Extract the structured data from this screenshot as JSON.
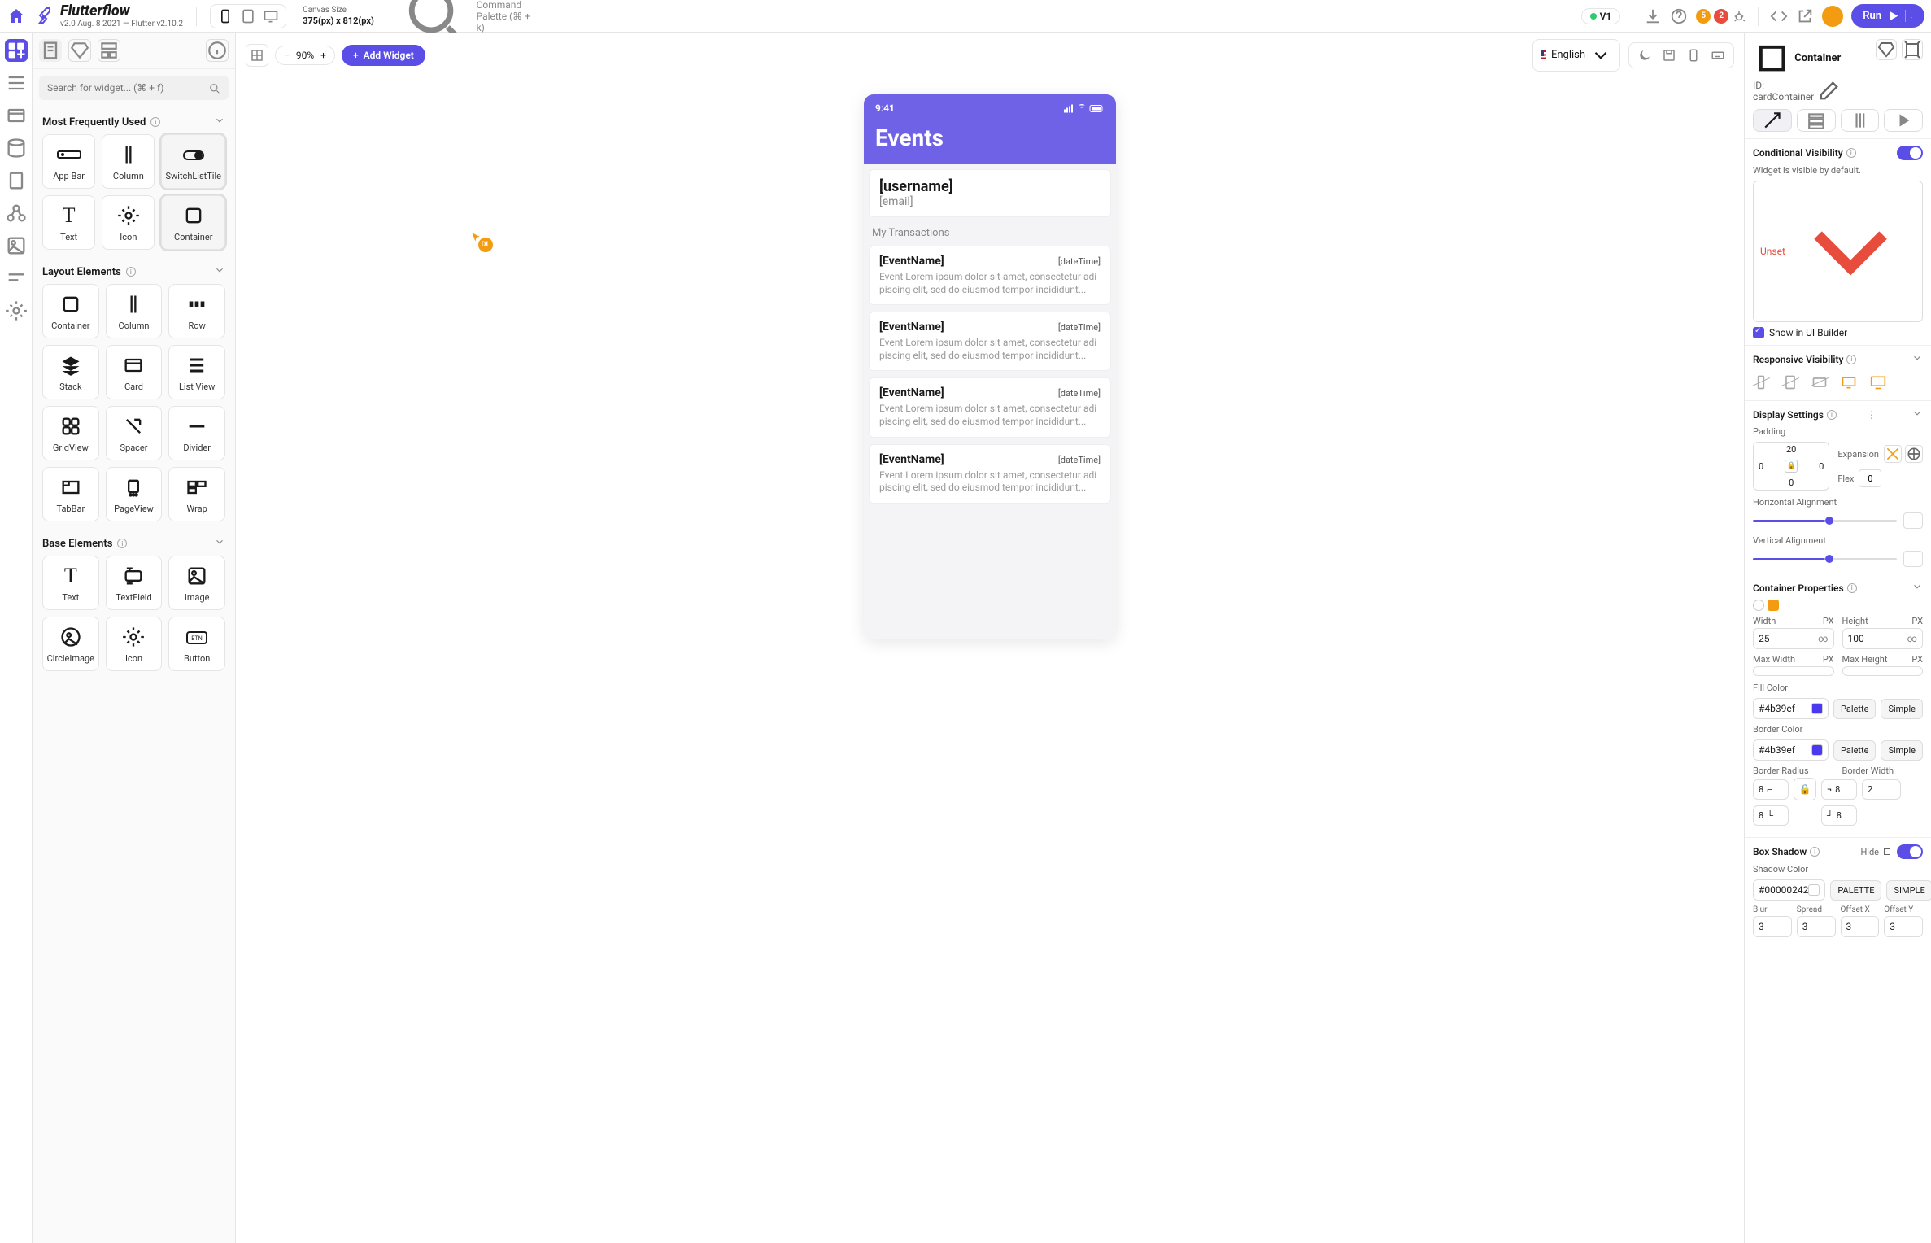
{
  "topbar": {
    "product": "Flutterflow",
    "subtitle": "v2.0 Aug. 8 2021 — Flutter v2.10.2",
    "canvas_label": "Canvas Size",
    "canvas_value": "375(px) x 812(px)",
    "command_palette": "Command Palette (⌘ + k)",
    "version": "V1",
    "badge1": "5",
    "badge2": "2",
    "run": "Run"
  },
  "widget_panel": {
    "search_placeholder": "Search for widget... (⌘ + f)",
    "sections": {
      "mfu": "Most Frequently Used",
      "layout": "Layout Elements",
      "base": "Base Elements"
    },
    "items": {
      "appbar": "App Bar",
      "column": "Column",
      "switchlisttile": "SwitchListTile",
      "text": "Text",
      "icon": "Icon",
      "container": "Container",
      "row": "Row",
      "stack": "Stack",
      "card": "Card",
      "listview": "List View",
      "gridview": "GridView",
      "spacer": "Spacer",
      "divider": "Divider",
      "tabbar": "TabBar",
      "pageview": "PageView",
      "wrap": "Wrap",
      "textfield": "TextField",
      "image": "Image",
      "circleimage": "CircleImage",
      "button": "Button"
    }
  },
  "canvas": {
    "zoom": "90%",
    "add_widget": "Add Widget",
    "language": "English",
    "collab_initials": "DL",
    "device": {
      "time": "9:41",
      "title": "Events",
      "username": "[username]",
      "email": "[email]",
      "section": "My Transactions",
      "events": [
        {
          "name": "[EventName]",
          "date": "[dateTime]",
          "desc": "Event Lorem ipsum dolor sit amet, consectetur adi piscing elit, sed do eiusmod tempor incididunt..."
        },
        {
          "name": "[EventName]",
          "date": "[dateTime]",
          "desc": "Event Lorem ipsum dolor sit amet, consectetur adi piscing elit, sed do eiusmod tempor incididunt..."
        },
        {
          "name": "[EventName]",
          "date": "[dateTime]",
          "desc": "Event Lorem ipsum dolor sit amet, consectetur adi piscing elit, sed do eiusmod tempor incididunt..."
        },
        {
          "name": "[EventName]",
          "date": "[dateTime]",
          "desc": "Event Lorem ipsum dolor sit amet, consectetur adi piscing elit, sed do eiusmod tempor incididunt..."
        }
      ]
    }
  },
  "props": {
    "widget_name": "Container",
    "widget_id": "ID: cardContainer",
    "conditional_visibility": "Conditional Visibility",
    "visible_default": "Widget is visible by default.",
    "unset": "Unset",
    "show_in_builder": "Show in UI Builder",
    "responsive_visibility": "Responsive Visibility",
    "display_settings": "Display Settings",
    "padding_label": "Padding",
    "padding": {
      "top": "20",
      "left": "0",
      "right": "0",
      "bottom": "0"
    },
    "expansion": "Expansion",
    "flex_label": "Flex",
    "flex_value": "0",
    "h_align": "Horizontal Alignment",
    "v_align": "Vertical Alignment",
    "container_properties": "Container Properties",
    "width_label": "Width",
    "height_label": "Height",
    "px": "PX",
    "width_value": "25",
    "height_value": "100",
    "max_width": "Max Width",
    "max_height": "Max Height",
    "fill_color": "Fill Color",
    "fill_hex": "#4b39ef",
    "border_color": "Border Color",
    "border_hex": "#4b39ef",
    "palette": "Palette",
    "simple": "Simple",
    "border_radius": "Border Radius",
    "border_width": "Border Width",
    "radius_tl": "8",
    "radius_tr": "8",
    "radius_bl": "8",
    "radius_br": "8",
    "border_width_value": "2",
    "box_shadow": "Box Shadow",
    "hide": "Hide",
    "shadow_color": "Shadow Color",
    "shadow_hex": "#00000242",
    "palette_upper": "PALETTE",
    "simple_upper": "SIMPLE",
    "blur": "Blur",
    "spread": "Spread",
    "offset_x": "Offset X",
    "offset_y": "Offset Y",
    "blur_v": "3",
    "spread_v": "3",
    "offx_v": "3",
    "offy_v": "3"
  }
}
